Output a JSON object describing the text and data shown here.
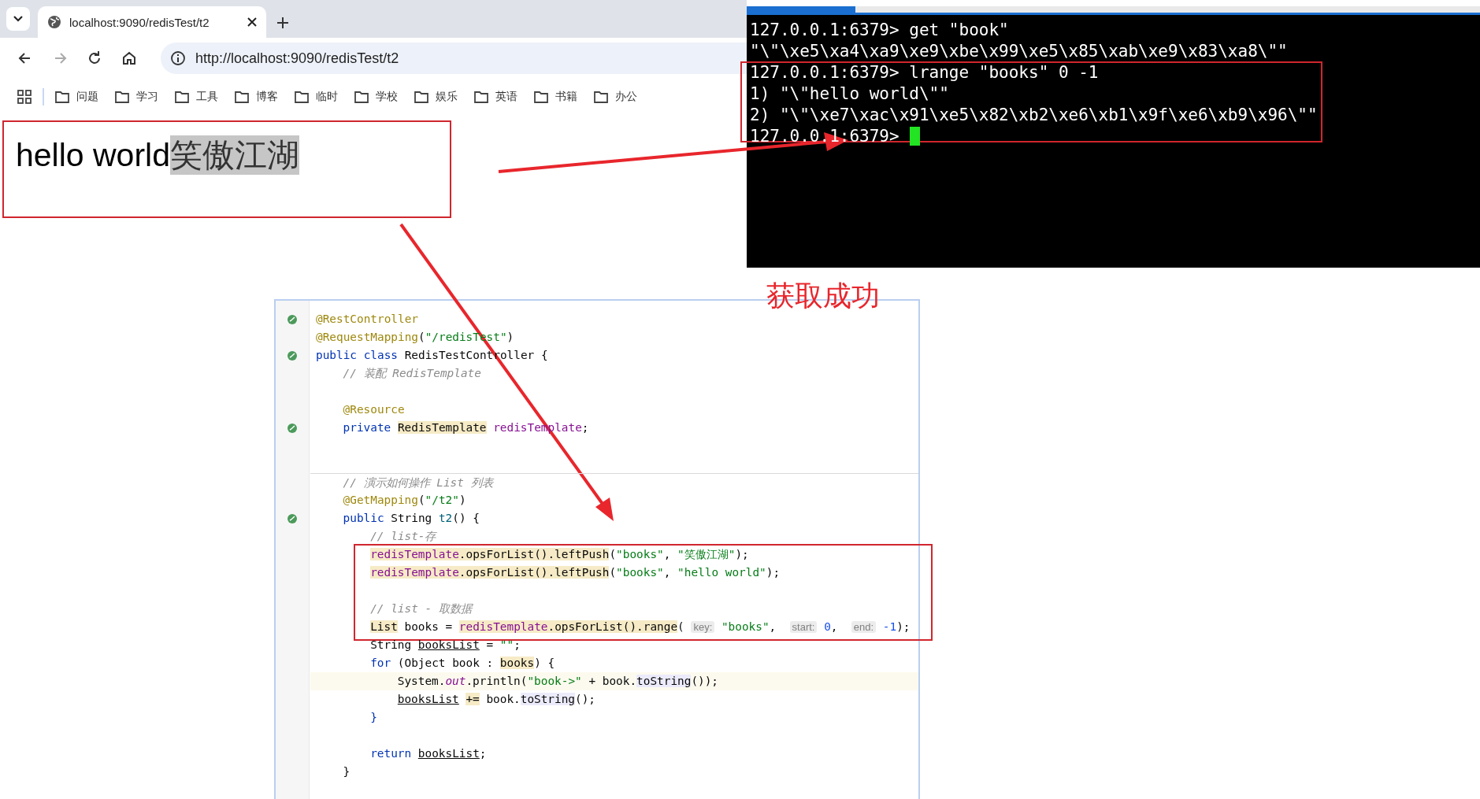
{
  "browser": {
    "tab": {
      "title": "localhost:9090/redisTest/t2"
    },
    "nav": [
      {
        "kind": "back",
        "disabled": false
      },
      {
        "kind": "forward",
        "disabled": true
      },
      {
        "kind": "reload",
        "disabled": false
      },
      {
        "kind": "home",
        "disabled": false
      }
    ],
    "url": "http://localhost:9090/redisTest/t2",
    "bookmarks": [
      {
        "label": "问题"
      },
      {
        "label": "学习"
      },
      {
        "label": "工具"
      },
      {
        "label": "博客"
      },
      {
        "label": "临时"
      },
      {
        "label": "学校"
      },
      {
        "label": "娱乐"
      },
      {
        "label": "英语"
      },
      {
        "label": "书籍"
      },
      {
        "label": "办公"
      }
    ]
  },
  "page": {
    "text_parts": [
      {
        "text": "hello world",
        "selected": false
      },
      {
        "text": "笑傲江湖",
        "selected": true
      }
    ]
  },
  "terminal": {
    "lines": [
      "127.0.0.1:6379> get \"book\"",
      "\"\\\"\\xe5\\xa4\\xa9\\xe9\\xbe\\x99\\xe5\\x85\\xab\\xe9\\x83\\xa8\\\"\"",
      "127.0.0.1:6379> lrange \"books\" 0 -1",
      "1) \"\\\"hello world\\\"\"",
      "2) \"\\\"\\xe7\\xac\\x91\\xe5\\x82\\xb2\\xe6\\xb1\\x9f\\xe6\\xb9\\x96\\\"\"",
      "127.0.0.1:6379>"
    ],
    "cursor": true
  },
  "caption": "获取成功",
  "editor": {
    "lines": [
      {
        "kind": "code",
        "marker": true,
        "tokens": [
          {
            "kind": "annotation",
            "text": "@RestController"
          }
        ]
      },
      {
        "kind": "code",
        "marker": false,
        "tokens": [
          {
            "kind": "annotation",
            "text": "@RequestMapping"
          },
          {
            "kind": "plain",
            "text": "("
          },
          {
            "kind": "string",
            "text": "\"/redisTest\""
          },
          {
            "kind": "plain",
            "text": ")"
          }
        ]
      },
      {
        "kind": "code",
        "marker": true,
        "tokens": [
          {
            "kind": "keyword",
            "text": "public class "
          },
          {
            "kind": "plain",
            "text": "RedisTestController {"
          }
        ],
        "children": [
          {
            "kind": "code",
            "marker": false,
            "tokens": [
              {
                "kind": "comment",
                "text": "// 装配 RedisTemplate"
              }
            ]
          },
          {
            "kind": "blank",
            "marker": false
          },
          {
            "kind": "code",
            "marker": false,
            "tokens": [
              {
                "kind": "annotation",
                "text": "@Resource"
              }
            ]
          },
          {
            "kind": "code",
            "marker": true,
            "tokens": [
              {
                "kind": "keyword",
                "text": "private "
              },
              {
                "kind": "usage",
                "text": "RedisTemplate"
              },
              {
                "kind": "field",
                "text": " redisTemplate"
              },
              {
                "kind": "plain",
                "text": ";"
              }
            ]
          },
          {
            "kind": "blank",
            "marker": false
          },
          {
            "kind": "blank",
            "marker": false
          },
          {
            "kind": "code",
            "marker": false,
            "separator": true,
            "tokens": [
              {
                "kind": "comment",
                "text": "// 演示如何操作 List 列表"
              }
            ]
          },
          {
            "kind": "code",
            "marker": false,
            "tokens": [
              {
                "kind": "annotation",
                "text": "@GetMapping"
              },
              {
                "kind": "plain",
                "text": "("
              },
              {
                "kind": "string",
                "text": "\"/t2\""
              },
              {
                "kind": "plain",
                "text": ")"
              }
            ]
          },
          {
            "kind": "code",
            "marker": true,
            "tokens": [
              {
                "kind": "keyword",
                "text": "public "
              },
              {
                "kind": "plain",
                "text": "String "
              },
              {
                "kind": "method",
                "text": "t2"
              },
              {
                "kind": "plain",
                "text": "() {"
              }
            ],
            "children": [
              {
                "kind": "code",
                "marker": false,
                "tokens": [
                  {
                    "kind": "comment",
                    "text": "// list-存"
                  }
                ]
              },
              {
                "kind": "code",
                "marker": false,
                "tokens": [
                  {
                    "kind": "fieldref",
                    "text": "redisTemplate"
                  },
                  {
                    "kind": "usage",
                    "text": ".opsForList().leftPush"
                  },
                  {
                    "kind": "plain",
                    "text": "("
                  },
                  {
                    "kind": "string",
                    "text": "\"books\""
                  },
                  {
                    "kind": "plain",
                    "text": ", "
                  },
                  {
                    "kind": "string",
                    "text": "\"笑傲江湖\""
                  },
                  {
                    "kind": "plain",
                    "text": ");"
                  }
                ]
              },
              {
                "kind": "code",
                "marker": false,
                "tokens": [
                  {
                    "kind": "fieldref",
                    "text": "redisTemplate"
                  },
                  {
                    "kind": "usage",
                    "text": ".opsForList().leftPush"
                  },
                  {
                    "kind": "plain",
                    "text": "("
                  },
                  {
                    "kind": "string",
                    "text": "\"books\""
                  },
                  {
                    "kind": "plain",
                    "text": ", "
                  },
                  {
                    "kind": "string",
                    "text": "\"hello world\""
                  },
                  {
                    "kind": "plain",
                    "text": ");"
                  }
                ]
              },
              {
                "kind": "blank",
                "marker": false
              },
              {
                "kind": "code",
                "marker": false,
                "tokens": [
                  {
                    "kind": "comment",
                    "text": "// list - 取数据"
                  }
                ]
              },
              {
                "kind": "code",
                "marker": false,
                "tokens": [
                  {
                    "kind": "usage",
                    "text": "List"
                  },
                  {
                    "kind": "plain",
                    "text": " books = "
                  },
                  {
                    "kind": "fieldref",
                    "text": "redisTemplate"
                  },
                  {
                    "kind": "usage",
                    "text": ".opsForList().range"
                  },
                  {
                    "kind": "plain",
                    "text": "( "
                  },
                  {
                    "kind": "hint",
                    "text": "key:"
                  },
                  {
                    "kind": "string",
                    "text": " \"books\""
                  },
                  {
                    "kind": "plain",
                    "text": ",  "
                  },
                  {
                    "kind": "hint",
                    "text": "start:"
                  },
                  {
                    "kind": "number",
                    "text": " 0"
                  },
                  {
                    "kind": "plain",
                    "text": ",  "
                  },
                  {
                    "kind": "hint",
                    "text": "end:"
                  },
                  {
                    "kind": "number",
                    "text": " -1"
                  },
                  {
                    "kind": "plain",
                    "text": ");"
                  }
                ]
              },
              {
                "kind": "code",
                "marker": false,
                "tokens": [
                  {
                    "kind": "plain",
                    "text": "String "
                  },
                  {
                    "kind": "underline",
                    "text": "booksList"
                  },
                  {
                    "kind": "plain",
                    "text": " = "
                  },
                  {
                    "kind": "string",
                    "text": "\"\""
                  },
                  {
                    "kind": "plain",
                    "text": ";"
                  }
                ]
              },
              {
                "kind": "code",
                "marker": false,
                "tokens": [
                  {
                    "kind": "keyword",
                    "text": "for "
                  },
                  {
                    "kind": "plain",
                    "text": "(Object book : "
                  },
                  {
                    "kind": "usage",
                    "text": "books"
                  },
                  {
                    "kind": "plain",
                    "text": ") {"
                  }
                ],
                "children": [
                  {
                    "kind": "code",
                    "marker": false,
                    "current": true,
                    "tokens": [
                      {
                        "kind": "plain",
                        "text": "System."
                      },
                      {
                        "kind": "static",
                        "text": "out"
                      },
                      {
                        "kind": "plain",
                        "text": ".println("
                      },
                      {
                        "kind": "string",
                        "text": "\"book->\""
                      },
                      {
                        "kind": "plain",
                        "text": " + book."
                      },
                      {
                        "kind": "call",
                        "text": "toString"
                      },
                      {
                        "kind": "plain",
                        "text": "());"
                      }
                    ]
                  },
                  {
                    "kind": "code",
                    "marker": false,
                    "current": false,
                    "tokens": [
                      {
                        "kind": "underline",
                        "text": "booksList"
                      },
                      {
                        "kind": "spaced-usage",
                        "text": "+="
                      },
                      {
                        "kind": "plain",
                        "text": " book."
                      },
                      {
                        "kind": "call",
                        "text": "toString"
                      },
                      {
                        "kind": "plain",
                        "text": "();"
                      }
                    ]
                  }
                ]
              },
              {
                "kind": "code",
                "marker": false,
                "tokens": [
                  {
                    "kind": "keyword",
                    "text": "}"
                  }
                ]
              },
              {
                "kind": "blank",
                "marker": false
              },
              {
                "kind": "code",
                "marker": false,
                "tokens": [
                  {
                    "kind": "keyword",
                    "text": "return "
                  },
                  {
                    "kind": "underline",
                    "text": "booksList"
                  },
                  {
                    "kind": "plain",
                    "text": ";"
                  }
                ]
              }
            ]
          },
          {
            "kind": "code",
            "marker": false,
            "tokens": [
              {
                "kind": "plain",
                "text": "}"
              }
            ]
          }
        ]
      }
    ]
  }
}
